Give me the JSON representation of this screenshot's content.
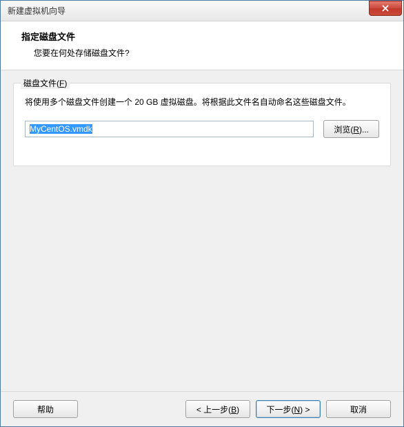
{
  "window": {
    "title": "新建虚拟机向导"
  },
  "header": {
    "title": "指定磁盘文件",
    "subtitle": "您要在何处存储磁盘文件?"
  },
  "group": {
    "legend_prefix": "磁盘文件(",
    "legend_key": "F",
    "legend_suffix": ")",
    "description": "将使用多个磁盘文件创建一个 20 GB 虚拟磁盘。将根据此文件名自动命名这些磁盘文件。",
    "input_value": "MyCentOS.vmdk",
    "browse_prefix": "浏览(",
    "browse_key": "R",
    "browse_suffix": ")..."
  },
  "footer": {
    "help": "帮助",
    "back_prefix": "< 上一步(",
    "back_key": "B",
    "back_suffix": ")",
    "next_prefix": "下一步(",
    "next_key": "N",
    "next_suffix": ") >",
    "cancel": "取消"
  }
}
